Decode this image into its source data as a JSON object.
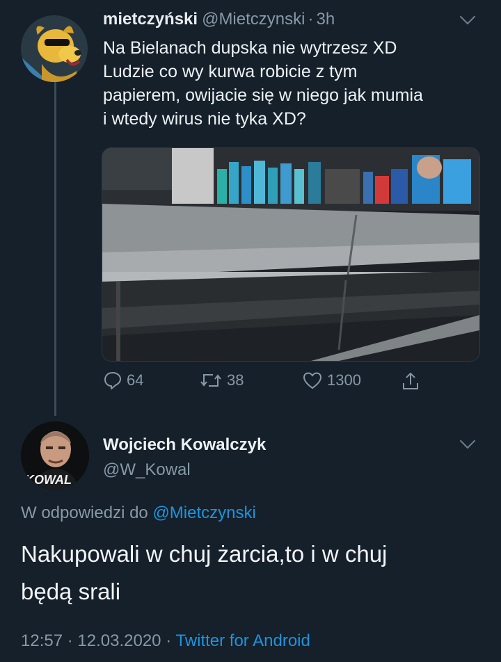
{
  "thread": {
    "parent_tweet": {
      "display_name": "mietczyński",
      "handle": "@Mietczynski",
      "separator": "·",
      "time": "3h",
      "text_lines": [
        "Na Bielanach dupska nie wytrzesz XD",
        "Ludzie co wy kurwa robicie z tym",
        "papierem, owijacie się w niego jak mumia",
        "i wtedy wirus nie tyka XD?"
      ],
      "avatar_icon": "dog-cartoon-avatar-icon",
      "media_description_icon": "store-shelf-photo",
      "actions": {
        "reply_count": "64",
        "retweet_count": "38",
        "like_count": "1300"
      }
    },
    "reply_tweet": {
      "display_name": "Wojciech Kowalczyk",
      "handle": "@W_Kowal",
      "avatar_icon": "man-portrait-avatar-icon",
      "avatar_text": "KOWAL",
      "replying_prefix": "W odpowiedzi do",
      "replying_to": "@Mietczynski",
      "text_lines": [
        "Nakupowali w chuj żarcia,to i w chuj",
        "będą srali"
      ],
      "time": "12:57",
      "separator1": "·",
      "date": "12.03.2020",
      "separator2": "·",
      "client": "Twitter for Android"
    }
  },
  "colors": {
    "background": "#15202b",
    "secondary_text": "#8899a6",
    "link": "#1b95e0",
    "thread_line": "#3b4a58"
  }
}
